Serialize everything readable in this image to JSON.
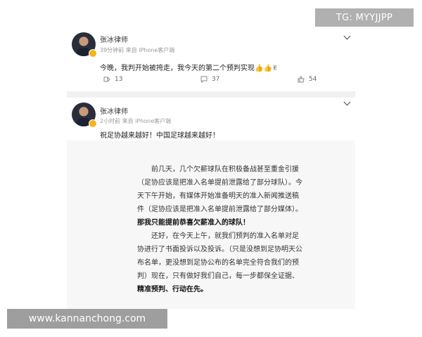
{
  "watermarks": {
    "tg": "TG: MYYJJPP",
    "site": "www.kannanchong.com"
  },
  "post1": {
    "author": "张冰律师",
    "meta": "39分钟前 来自 iPhone客户端",
    "text": "今晚，我判开始被挎走，我今天的第二个预判实现👍👍✌",
    "actions": {
      "repost": "13",
      "comment": "37",
      "like": "54"
    }
  },
  "post2": {
    "author": "张冰律师",
    "meta": "2小时前 来自 iPhone客户端",
    "text": "祝足协越来越好！中国足球越来越好！",
    "document": {
      "lines": [
        "　　前几天，几个欠薪球队在积极备战甚至重金引援",
        "（足协应该是把准入名单提前泄露给了部分球队）。今",
        "天下午开始，有媒体开始准备明天的准入新闻推送稿",
        "件（足协应该是把准入名单提前泄露给了部分媒体）。",
        "那我只能提前恭喜欠薪准入的球队！",
        "　　还好，在今天上午，就我们预判的准入名单对足",
        "协进行了书面投诉以及投诉。（只是没想到足协明天公",
        "布名单，更没想到足协公布的名单完全符合我们的预",
        "判）现在，只有做好我们自己，每一步都保全证据、",
        "精准预判、行动在先。"
      ]
    }
  }
}
